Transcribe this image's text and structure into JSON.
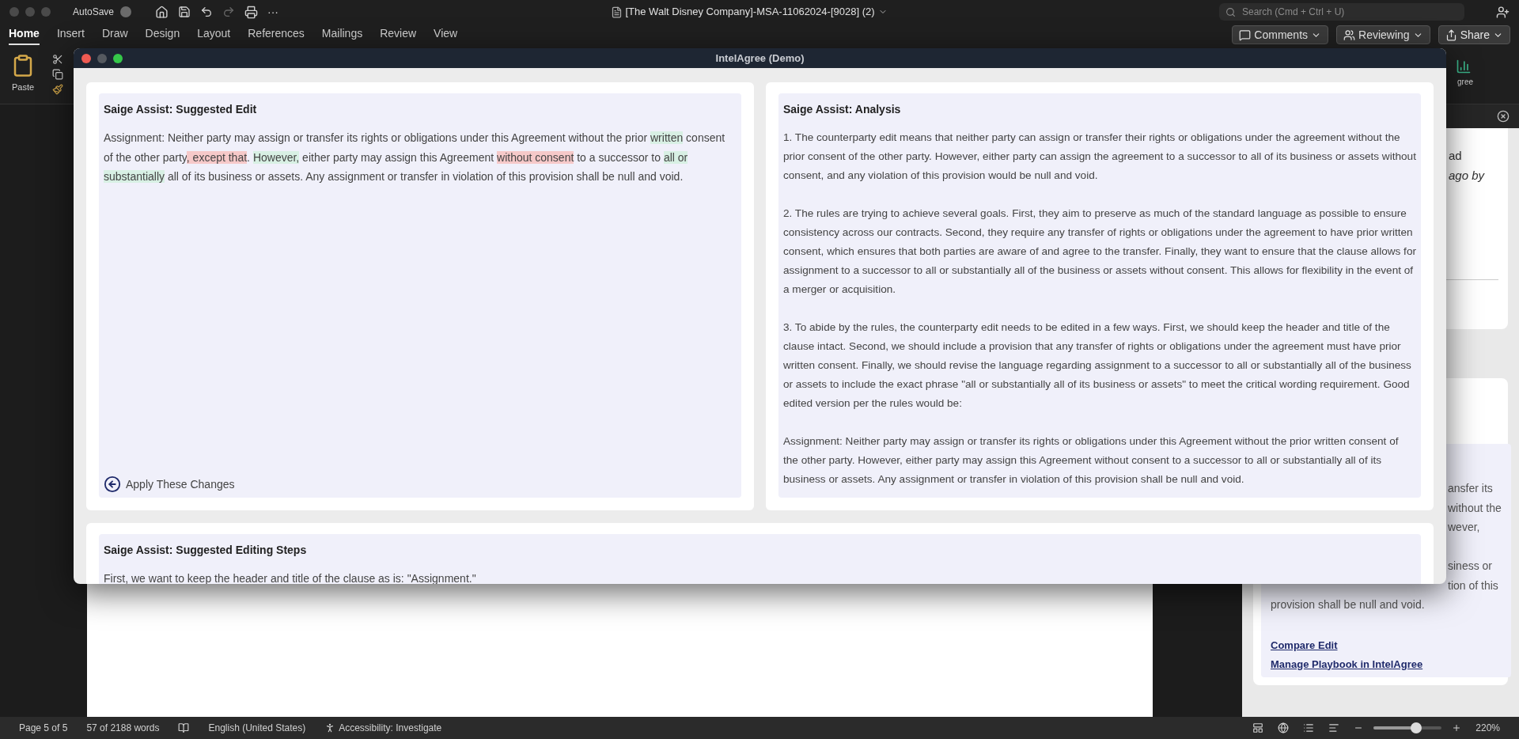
{
  "title_bar": {
    "autosave": {
      "label": "AutoSave",
      "on": false
    },
    "more": "···",
    "document_title": "[The Walt Disney Company]-MSA-11062024-[9028] (2)",
    "search": {
      "placeholder": "Search (Cmd + Ctrl + U)"
    }
  },
  "ribbon_tabs": [
    {
      "label": "Home",
      "selected": true
    },
    {
      "label": "Insert",
      "selected": false
    },
    {
      "label": "Draw",
      "selected": false
    },
    {
      "label": "Design",
      "selected": false
    },
    {
      "label": "Layout",
      "selected": false
    },
    {
      "label": "References",
      "selected": false
    },
    {
      "label": "Mailings",
      "selected": false
    },
    {
      "label": "Review",
      "selected": false
    },
    {
      "label": "View",
      "selected": false
    }
  ],
  "ribbon_buttons": [
    {
      "kind": "comments",
      "label": "Comments"
    },
    {
      "kind": "reviewing",
      "label": "Reviewing"
    },
    {
      "kind": "share",
      "label": "Share"
    }
  ],
  "ribbon": {
    "paste_label": "Paste",
    "cut_off_label": "gree"
  },
  "side_pane": {
    "card_fragments": [
      {
        "text": "ad",
        "kind": "plain"
      },
      {
        "text": "ago by",
        "kind": "italic"
      }
    ],
    "clause_fragments": [
      "ansfer its",
      "without the",
      "wever,",
      "siness or",
      "tion of this"
    ],
    "clause_end": "provision shall be null and void.",
    "links": [
      "Compare Edit",
      "Manage Playbook in IntelAgree"
    ]
  },
  "dialog": {
    "title": "IntelAgree (Demo)",
    "suggested_edit": {
      "title": "Saige Assist: Suggested Edit",
      "segments": [
        {
          "kind": "plain",
          "text": "Assignment: Neither party may assign or transfer its rights or obligations under this Agreement without the prior "
        },
        {
          "kind": "inserted",
          "text": "written"
        },
        {
          "kind": "plain",
          "text": " consent of the other party"
        },
        {
          "kind": "deleted",
          "text": ", except that"
        },
        {
          "kind": "plain",
          "text": ". "
        },
        {
          "kind": "inserted",
          "text": "However,"
        },
        {
          "kind": "plain",
          "text": " either party may assign this Agreement "
        },
        {
          "kind": "deleted",
          "text": "without consent"
        },
        {
          "kind": "plain",
          "text": " to a successor to "
        },
        {
          "kind": "inserted",
          "text": "all or substantially"
        },
        {
          "kind": "plain",
          "text": " all of its business or assets. Any assignment or transfer in violation of this provision shall be null and void."
        }
      ],
      "apply_label": "Apply These Changes"
    },
    "analysis": {
      "title": "Saige Assist: Analysis",
      "paragraphs": [
        "1. The counterparty edit means that neither party can assign or transfer their rights or obligations under the agreement without the prior consent of the other party. However, either party can assign the agreement to a successor to all of its business or assets without consent, and any violation of this provision would be null and void.",
        "2. The rules are trying to achieve several goals. First, they aim to preserve as much of the standard language as possible to ensure consistency across our contracts. Second, they require any transfer of rights or obligations under the agreement to have prior written consent, which ensures that both parties are aware of and agree to the transfer. Finally, they want to ensure that the clause allows for assignment to a successor to all or substantially all of the business or assets without consent. This allows for flexibility in the event of a merger or acquisition.",
        "3. To abide by the rules, the counterparty edit needs to be edited in a few ways. First, we should keep the header and title of the clause intact. Second, we should include a provision that any transfer of rights or obligations under the agreement must have prior written consent. Finally, we should revise the language regarding assignment to a successor to all or substantially all of the business or assets to include the exact phrase \"all or substantially all of its business or assets\" to meet the critical wording requirement. Good edited version per the rules would be:",
        "Assignment: Neither party may assign or transfer its rights or obligations under this Agreement without the prior written consent of the other party. However, either party may assign this Agreement without consent to a successor to all or substantially all of its business or assets. Any assignment or transfer in violation of this provision shall be null and void."
      ]
    },
    "editing_steps": {
      "title": "Saige Assist: Suggested Editing Steps",
      "text": "First, we want to keep the header and title of the clause as is: \"Assignment.\""
    }
  },
  "status_bar": {
    "page": "Page 5 of 5",
    "words": "57 of 2188 words",
    "language": "English (United States)",
    "accessibility": "Accessibility: Investigate",
    "zoom": {
      "level": 0.62,
      "reading": "220%"
    }
  }
}
